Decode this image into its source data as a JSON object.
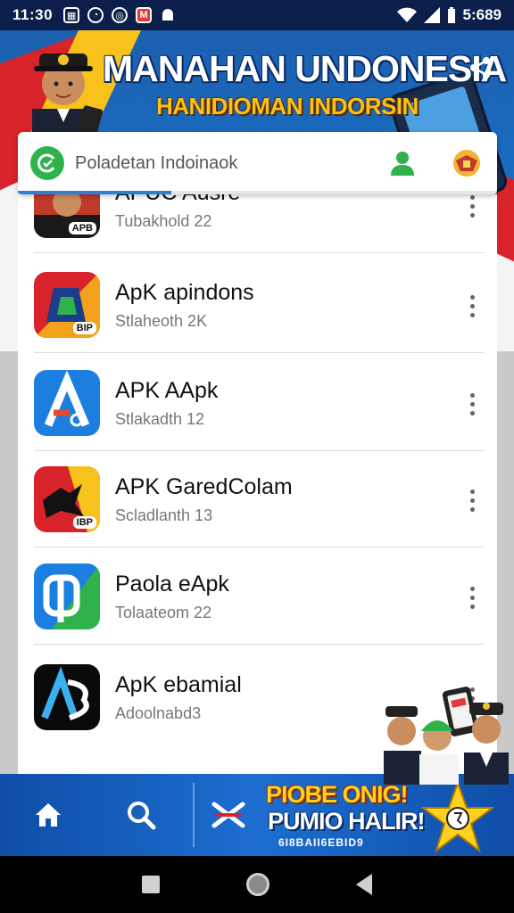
{
  "status_bar": {
    "time": "11:30",
    "notification_icons": [
      "calendar-icon",
      "whatsapp-icon",
      "chrome-icon",
      "gmail-icon",
      "android-icon"
    ],
    "clock_right": "5:689"
  },
  "banner": {
    "title": "MANAHAN UNDONESIA",
    "subtitle": "HANIDIOMAN INDORSIN"
  },
  "search": {
    "placeholder": "Poladetan Indoinaok",
    "progress_fraction": 0.32
  },
  "apps": [
    {
      "name": "APUC Ausre",
      "sub": "Tubakhold 22",
      "icon": "officer-app-icon",
      "colors": [
        "#1a1a1a",
        "#c0392b"
      ],
      "icon_text": "APB"
    },
    {
      "name": "ApK apindons",
      "sub": "Stlaheoth 2K",
      "icon": "garuda-app-icon",
      "colors": [
        "#d8232a",
        "#f3a21b"
      ],
      "icon_text": "BIP"
    },
    {
      "name": "APK AApk",
      "sub": "Stlakadth 12",
      "icon": "a-logo-app-icon",
      "colors": [
        "#1c7fe0",
        "#2aa6f0"
      ],
      "icon_text": ""
    },
    {
      "name": "APK GaredColam",
      "sub": "Scladlanth 13",
      "icon": "eagle-app-icon",
      "colors": [
        "#d8232a",
        "#f7c21b"
      ],
      "icon_text": "IBP"
    },
    {
      "name": "Paola eApk",
      "sub": "Tolaateom 22",
      "icon": "p-logo-app-icon",
      "colors": [
        "#1c7fe0",
        "#2fb24c"
      ],
      "icon_text": ""
    },
    {
      "name": "ApK ebamial",
      "sub": "Adoolnabd3",
      "icon": "ab-logo-app-icon",
      "colors": [
        "#0a0a0a",
        "#3ab0f0"
      ],
      "icon_text": ""
    }
  ],
  "bottom_bar": {
    "promo_line1": "PIOBE ONIG!",
    "promo_line2": "PUMIO HALIR!",
    "promo_line3": "6I8BAII6EBID9"
  },
  "colors": {
    "accent_blue": "#1c6ed0",
    "accent_red": "#d8232a",
    "accent_yellow": "#f7c21b",
    "search_logo_green": "#2fb24c"
  }
}
